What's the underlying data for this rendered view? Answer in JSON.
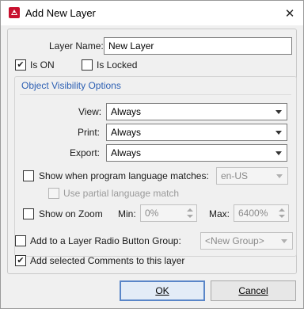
{
  "window": {
    "title": "Add New Layer",
    "close_icon": "close-icon"
  },
  "colors": {
    "accent": "#2c5fb3",
    "app_icon": "#c8102e"
  },
  "layer_name": {
    "label": "Layer Name:",
    "value": "New Layer"
  },
  "is_on": {
    "label": "Is ON",
    "checked": true
  },
  "is_locked": {
    "label": "Is Locked",
    "checked": false
  },
  "visibility": {
    "title": "Object Visibility Options",
    "view": {
      "label": "View:",
      "value": "Always"
    },
    "print": {
      "label": "Print:",
      "value": "Always"
    },
    "export": {
      "label": "Export:",
      "value": "Always"
    },
    "language": {
      "label": "Show when program language matches:",
      "checked": false,
      "value": "en-US"
    },
    "partial": {
      "label": "Use partial language match",
      "checked": false
    },
    "zoom": {
      "label": "Show on Zoom",
      "checked": false,
      "min_label": "Min:",
      "min_value": "0%",
      "max_label": "Max:",
      "max_value": "6400%"
    }
  },
  "radio_group": {
    "label": "Add to a Layer Radio Button Group:",
    "checked": false,
    "value": "<New Group>"
  },
  "add_comments": {
    "label": "Add selected Comments to this layer",
    "checked": true
  },
  "buttons": {
    "ok": "OK",
    "cancel": "Cancel"
  }
}
